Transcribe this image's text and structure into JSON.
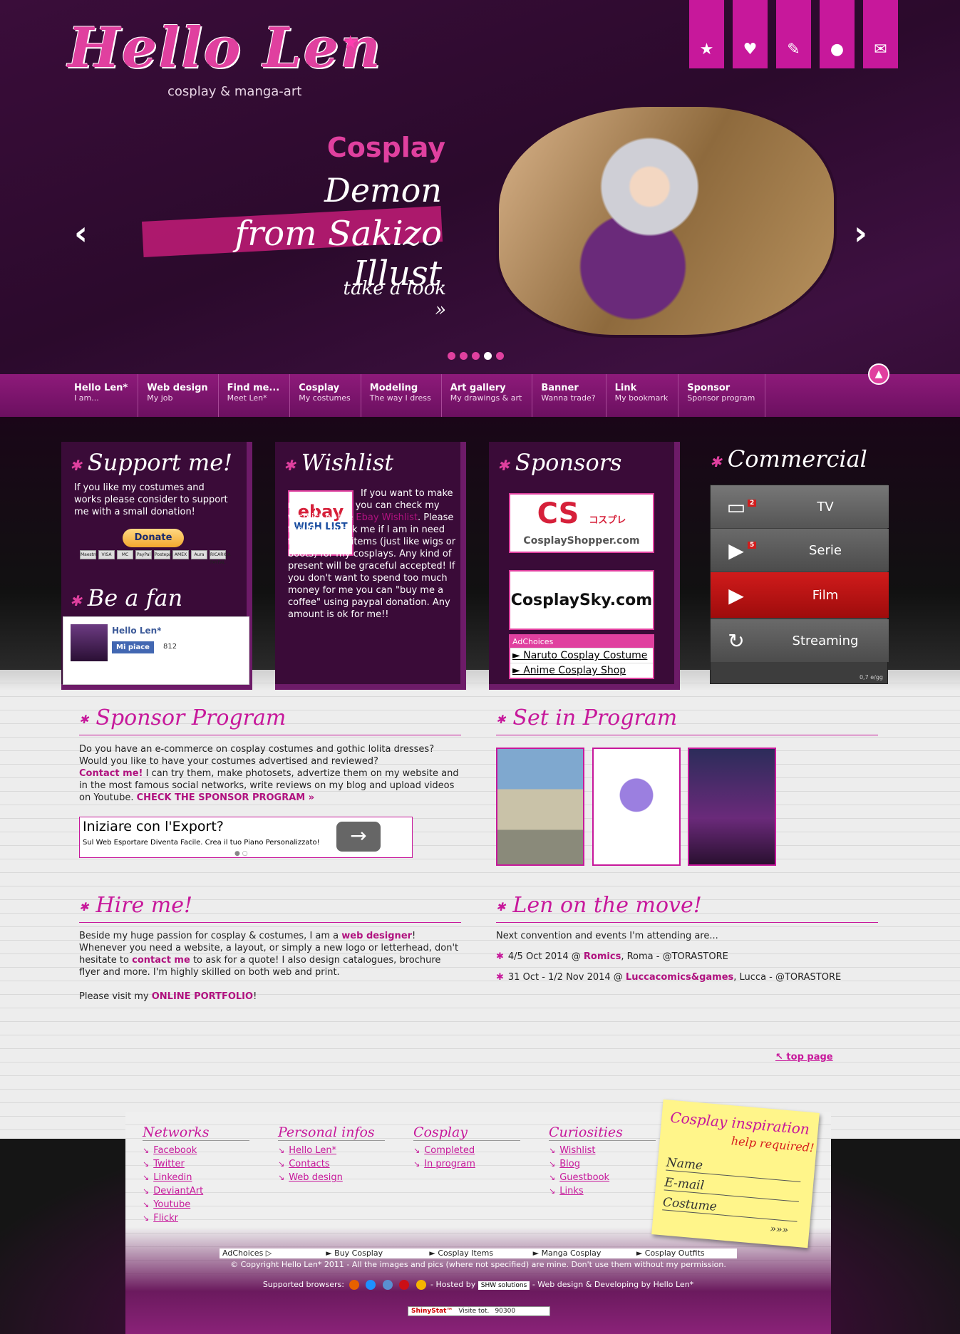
{
  "header": {
    "logo_title": "Hello Len",
    "logo_subtitle": "cosplay & manga-art",
    "top_icons": [
      "star-icon",
      "heart-icon",
      "pencil-icon",
      "chat-icon",
      "mail-icon"
    ]
  },
  "slider": {
    "category": "Cosplay",
    "title_line1": "Demon",
    "title_line2": "from Sakizo Illust",
    "link": "take a look »",
    "prev": "‹",
    "next": "›",
    "dots_total": 5,
    "dots_active": 4
  },
  "nav": {
    "items": [
      {
        "title": "Hello Len*",
        "sub": "I am..."
      },
      {
        "title": "Web design",
        "sub": "My job"
      },
      {
        "title": "Find me...",
        "sub": "Meet Len*"
      },
      {
        "title": "Cosplay",
        "sub": "My costumes"
      },
      {
        "title": "Modeling",
        "sub": "The way I dress"
      },
      {
        "title": "Art gallery",
        "sub": "My drawings & art"
      },
      {
        "title": "Banner",
        "sub": "Wanna trade?"
      },
      {
        "title": "Link",
        "sub": "My bookmark"
      },
      {
        "title": "Sponsor",
        "sub": "Sponsor program"
      }
    ]
  },
  "support": {
    "title": "Support me!",
    "text": "If you like my costumes and works please consider to support me with a small donation!",
    "donate": "Donate",
    "cards": [
      "Maestro",
      "VISA",
      "MC",
      "PayPal",
      "Postepay",
      "AMEX",
      "Aura",
      "RICARICA PAYPAL"
    ]
  },
  "fan": {
    "title": "Be a fan",
    "name": "Hello Len*",
    "like": "Mi piace",
    "count": "812"
  },
  "wishlist": {
    "title": "Wishlist",
    "ebay_logo": "ebay",
    "ebay_sub": "WISH LIST",
    "text1": "If you want to make me a present, you can check my wishlist or the ",
    "link": "Ebay Wishlist",
    "text2": ". Please feel free to ask me if I am in need for particular items (just like wigs or boots) for my cosplays. Any kind of present will be graceful accepted! If you don't want to spend too much money for me you can \"buy me a coffee\" using paypal donation. Any amount is ok for me!!"
  },
  "sponsors": {
    "title": "Sponsors",
    "ad1_main": "CS",
    "ad1_jp": "コスプレ",
    "ad1_sub": "CosplayShopper.com",
    "ad2": "CosplaySky.com",
    "adchoices": "AdChoices",
    "links": [
      "► Naruto Cosplay Costume",
      "► Anime Cosplay Shop"
    ]
  },
  "commercial": {
    "title": "Commercial",
    "rows": [
      {
        "label": "TV",
        "icon": "tv-icon",
        "badge": "2"
      },
      {
        "label": "Serie",
        "icon": "play-icon",
        "badge": "5"
      },
      {
        "label": "Film",
        "icon": "film-icon",
        "badge": ""
      },
      {
        "label": "Streaming",
        "icon": "refresh-icon",
        "badge": ""
      }
    ],
    "price": "0,7 e/gg"
  },
  "sponsor_program": {
    "title": "Sponsor Program",
    "text1": "Do you have an e-commerce on cosplay costumes and gothic lolita dresses? Would you like to have your costumes advertised and reviewed?",
    "contact": "Contact me!",
    "text2": " I can try them, make photosets, advertize them on my website and in the most famous social networks, write reviews on my blog and upload videos on Youtube. ",
    "cta": "CHECK THE SPONSOR PROGRAM »",
    "ad_title": "Iniziare con l'Export?",
    "ad_desc": "Sul Web Esportare Diventa Facile. Crea il tuo Piano Personalizzato!"
  },
  "set_in_program": {
    "title": "Set in Program"
  },
  "hire": {
    "title": "Hire me!",
    "t1": "Beside my huge passion for cosplay & costumes, I am a ",
    "l1": "web designer",
    "t2": "! Whenever you need a website, a layout, or simply a new logo or letterhead, don't hesitate to ",
    "l2": "contact me",
    "t3": " to ask for a quote! I also design catalogues, brochure flyer and more. I'm highly skilled on both web and print.",
    "t4": "Please visit my ",
    "l3": "ONLINE PORTFOLIO",
    "t5": "!"
  },
  "move": {
    "title": "Len on the move!",
    "intro": "Next convention and events I'm attending are...",
    "events": [
      {
        "pre": "4/5 Oct 2014 @ ",
        "link": "Romics",
        "post": ", Roma - @TORASTORE"
      },
      {
        "pre": "31 Oct - 1/2 Nov 2014 @ ",
        "link": "Luccacomics&games",
        "post": ", Lucca - @TORASTORE"
      }
    ]
  },
  "footer": {
    "top_page": "top page",
    "cols": [
      {
        "title": "Networks",
        "links": [
          "Facebook",
          "Twitter",
          "Linkedin",
          "DeviantArt",
          "Youtube",
          "Flickr"
        ]
      },
      {
        "title": "Personal infos",
        "links": [
          "Hello Len*",
          "Contacts",
          "Web design"
        ]
      },
      {
        "title": "Cosplay",
        "links": [
          "Completed",
          "In program"
        ]
      },
      {
        "title": "Curiosities",
        "links": [
          "Wishlist",
          "Blog",
          "Guestbook",
          "Links"
        ]
      }
    ],
    "note_title": "Cosplay inspiration",
    "note_sub": "help required!",
    "note_fields": [
      "Name",
      "E-mail",
      "Costume"
    ],
    "note_go": "»»»",
    "adbar": [
      "AdChoices ▷",
      "► Buy Cosplay",
      "► Cosplay Items",
      "► Manga Cosplay",
      "► Cosplay Outfits"
    ],
    "copyright": "© Copyright Hello Len* 2011 - All the images and pics (where not specified) are mine. Don't use them without my permission.",
    "browsers_label": "Supported browsers:",
    "hosted": "- Hosted by",
    "host": "SHW solutions",
    "design": "- Web design & Developing by Hello Len*",
    "stat_name": "ShinyStat™",
    "stat_label": "Visite tot.",
    "stat_value": "90300"
  },
  "colors": {
    "accent": "#c7189b",
    "dark": "#3a0b38"
  }
}
